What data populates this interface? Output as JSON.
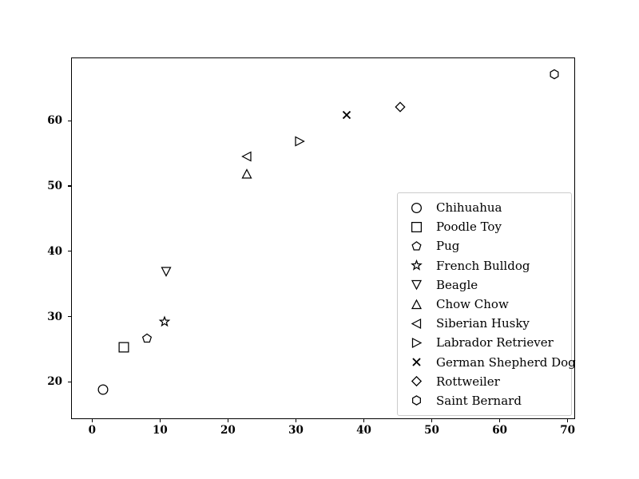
{
  "chart_data": {
    "type": "scatter",
    "title": "",
    "xlabel": "",
    "ylabel": "",
    "xlim": [
      -3.1,
      71.1
    ],
    "ylim": [
      14.3,
      69.7
    ],
    "grid": false,
    "legend_position": "center right",
    "xticks": [
      "0",
      "10",
      "20",
      "30",
      "40",
      "50",
      "60",
      "70"
    ],
    "xtick_values": [
      0,
      10,
      20,
      30,
      40,
      50,
      60,
      70
    ],
    "yticks": [
      "20",
      "30",
      "40",
      "50",
      "60"
    ],
    "ytick_values": [
      20,
      30,
      40,
      50,
      60
    ],
    "marker_color": "#000000",
    "series": [
      {
        "name": "Chihuahua",
        "marker": "circle",
        "x": 1.5,
        "y": 19.0
      },
      {
        "name": "Poodle Toy",
        "marker": "square",
        "x": 4.5,
        "y": 25.4
      },
      {
        "name": "Pug",
        "marker": "pentagon",
        "x": 8.0,
        "y": 26.8
      },
      {
        "name": "French Bulldog",
        "marker": "star",
        "x": 10.5,
        "y": 29.4
      },
      {
        "name": "Beagle",
        "marker": "triangle-down",
        "x": 10.8,
        "y": 37.0
      },
      {
        "name": "Chow Chow",
        "marker": "triangle-up",
        "x": 22.6,
        "y": 52.0
      },
      {
        "name": "Siberian Husky",
        "marker": "triangle-left",
        "x": 22.6,
        "y": 54.7
      },
      {
        "name": "Labrador Retriever",
        "marker": "triangle-right",
        "x": 30.4,
        "y": 57.0
      },
      {
        "name": "German Shepherd Dog",
        "marker": "x",
        "x": 37.4,
        "y": 61.0
      },
      {
        "name": "Rottweiler",
        "marker": "diamond",
        "x": 45.2,
        "y": 62.3
      },
      {
        "name": "Saint Bernard",
        "marker": "hexagon",
        "x": 67.9,
        "y": 67.2
      }
    ]
  },
  "legend": {
    "entries": [
      "Chihuahua",
      "Poodle Toy",
      "Pug",
      "French Bulldog",
      "Beagle",
      "Chow Chow",
      "Siberian Husky",
      "Labrador Retriever",
      "German Shepherd Dog",
      "Rottweiler",
      "Saint Bernard"
    ]
  }
}
